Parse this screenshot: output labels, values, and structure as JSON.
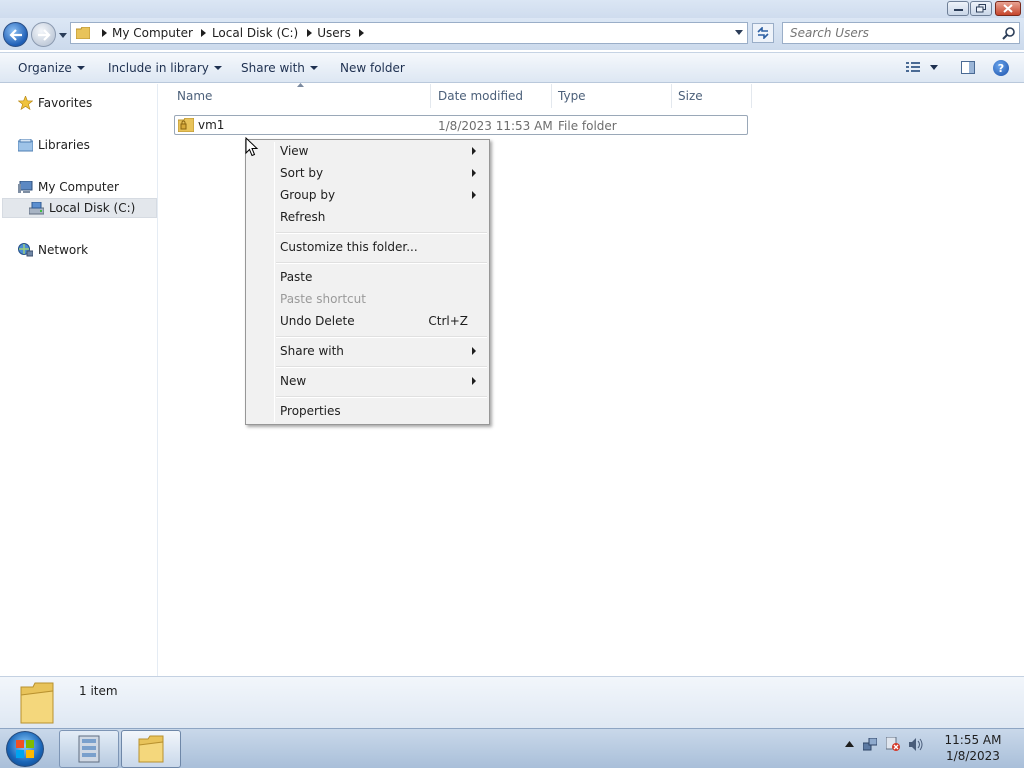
{
  "window": {
    "buttons": {
      "minimize": "minimize",
      "maximize": "maximize",
      "close": "close"
    }
  },
  "address": {
    "breadcrumbs": [
      "My Computer",
      "Local Disk (C:)",
      "Users"
    ]
  },
  "search": {
    "placeholder": "Search Users"
  },
  "toolbar": {
    "organize": "Organize",
    "include_in_library": "Include in library",
    "share_with": "Share with",
    "new_folder": "New folder"
  },
  "sidebar": {
    "favorites": "Favorites",
    "libraries": "Libraries",
    "computer": "My Computer",
    "local_disk": "Local Disk (C:)",
    "network": "Network"
  },
  "columns": {
    "name": "Name",
    "date_modified": "Date modified",
    "type": "Type",
    "size": "Size"
  },
  "files": [
    {
      "name": "vm1",
      "date_modified": "1/8/2023 11:53 AM",
      "type": "File folder",
      "size": ""
    }
  ],
  "context_menu": {
    "view": "View",
    "sort_by": "Sort by",
    "group_by": "Group by",
    "refresh": "Refresh",
    "customize": "Customize this folder...",
    "paste": "Paste",
    "paste_shortcut": "Paste shortcut",
    "undo_delete": "Undo Delete",
    "undo_delete_shortcut": "Ctrl+Z",
    "share_with": "Share with",
    "new": "New",
    "properties": "Properties"
  },
  "details": {
    "item_count": "1 item"
  },
  "taskbar": {
    "time": "11:55 AM",
    "date": "1/8/2023"
  },
  "colors": {
    "accent": "#1f5fb6",
    "titlebar": "#d5e1f1",
    "close_button": "#c6452c",
    "folder": "#e8c35a"
  },
  "icons": [
    "back-arrow-icon",
    "forward-arrow-icon",
    "folder-icon",
    "search-icon",
    "refresh-icon",
    "star-icon",
    "library-icon",
    "computer-icon",
    "drive-icon",
    "network-icon",
    "help-icon",
    "start-orb-icon"
  ]
}
